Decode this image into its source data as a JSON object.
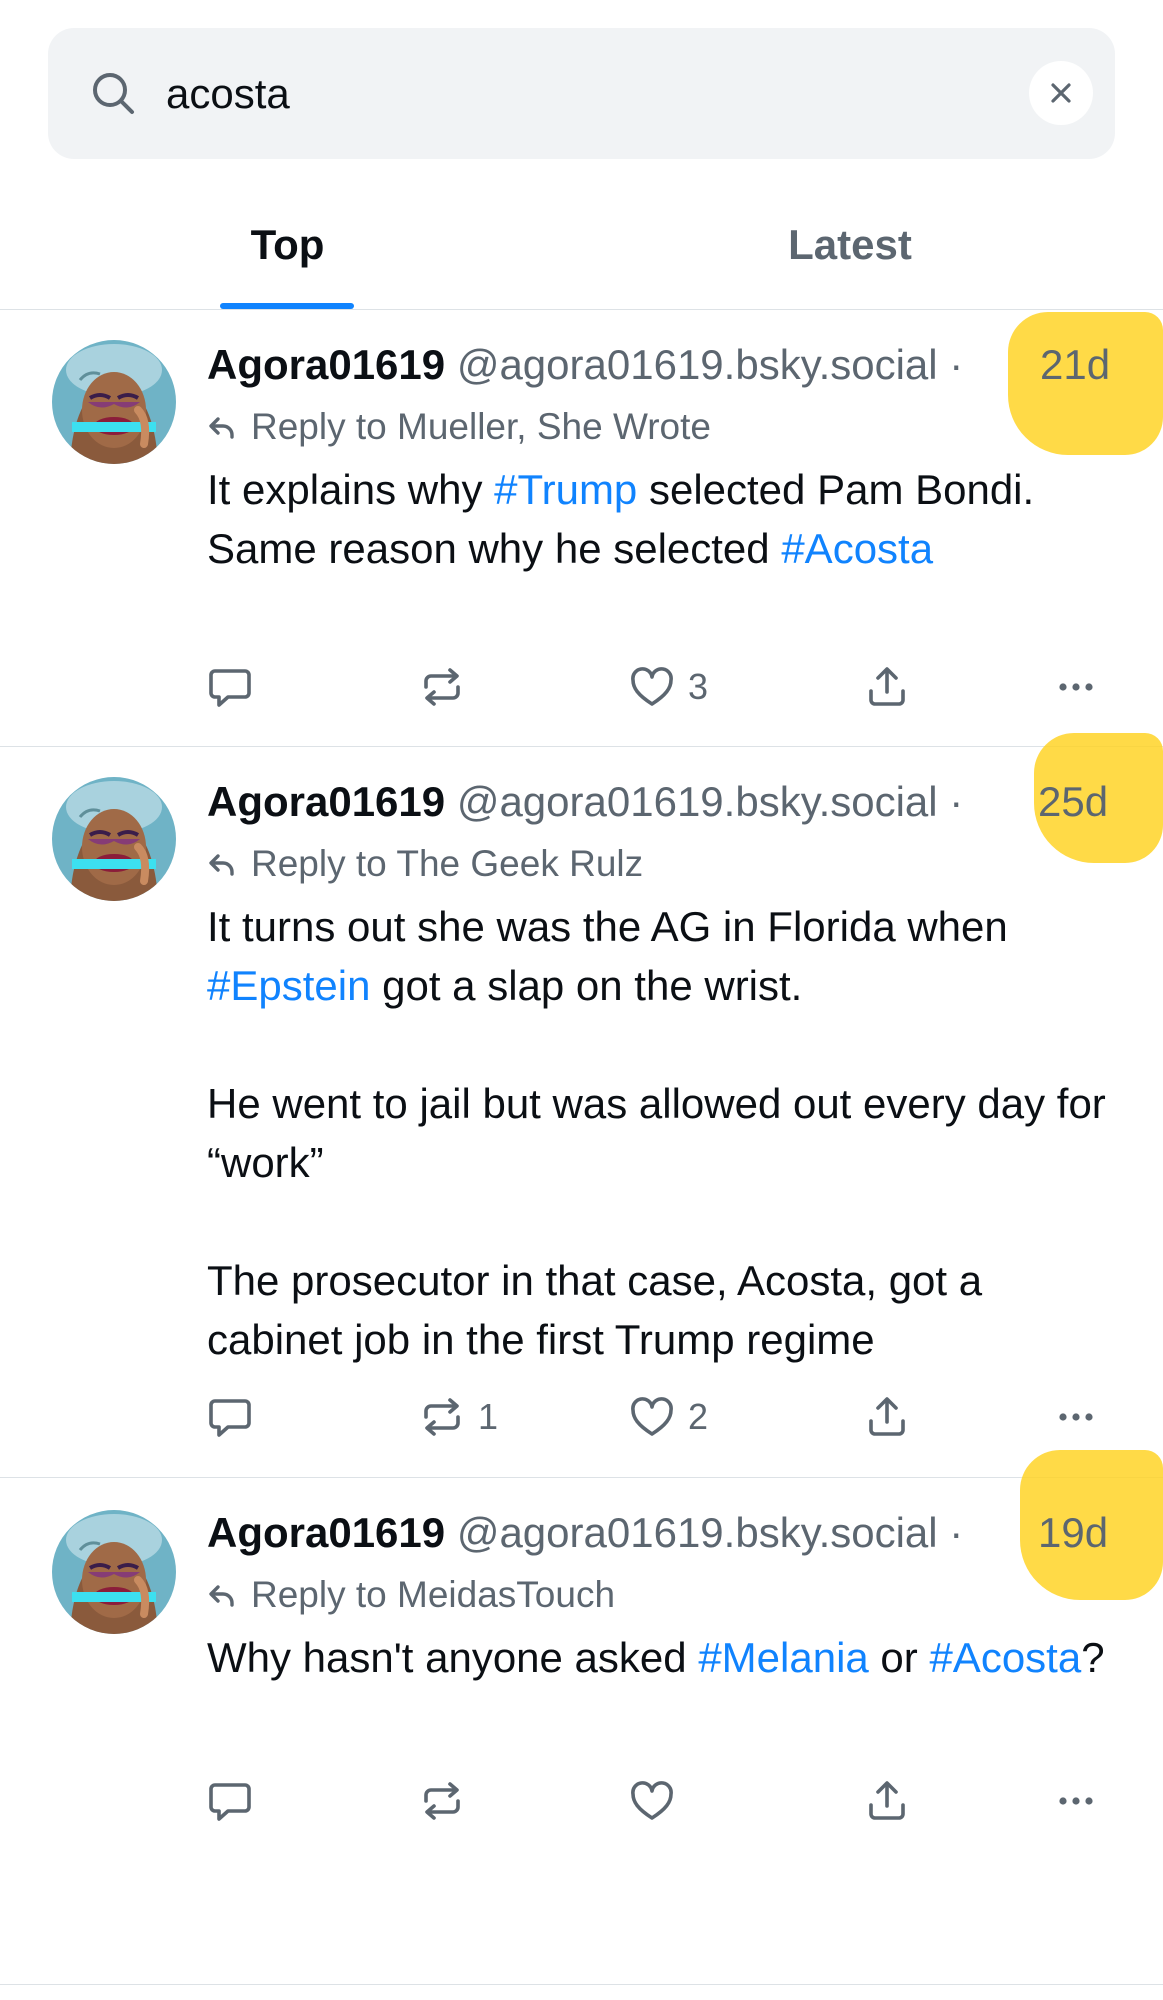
{
  "search": {
    "query": "acosta"
  },
  "tabs": [
    {
      "label": "Top"
    },
    {
      "label": "Latest"
    }
  ],
  "colors": {
    "accent": "#1083fe",
    "muted": "#5c6670",
    "highlight": "#ffd21f"
  },
  "icons": {
    "search": "search-icon",
    "clear": "close-icon",
    "reply": "reply-arrow-icon",
    "comment": "comment-icon",
    "repost": "repost-icon",
    "like": "heart-icon",
    "share": "share-icon",
    "more": "more-icon"
  },
  "posts": [
    {
      "display_name": "Agora01619",
      "handle": "@agora01619.bsky.social",
      "separator": "·",
      "time": "21d",
      "reply_to": "Reply to Mueller, She Wrote",
      "text": {
        "t1": "It explains why ",
        "tag1": "#Trump",
        "t2": " selected Pam Bondi.",
        "t3": "Same reason why he selected ",
        "tag2": "#Acosta"
      },
      "counts": {
        "reposts": "",
        "likes": "3"
      }
    },
    {
      "display_name": "Agora01619",
      "handle": "@agora01619.bsky.social",
      "separator": "·",
      "time": "25d",
      "reply_to": "Reply to The Geek Rulz",
      "text": {
        "t1": "It turns out she was the AG in Florida when ",
        "tag1": "#Epstein",
        "t2": " got a slap on the wrist.",
        "p2": "He went to jail but was allowed out every day for “work”",
        "p3": "The prosecutor in that case, Acosta, got a cabinet job in the first Trump regime"
      },
      "counts": {
        "reposts": "1",
        "likes": "2"
      }
    },
    {
      "display_name": "Agora01619",
      "handle": "@agora01619.bsky.social",
      "separator": "·",
      "time": "19d",
      "reply_to": "Reply to MeidasTouch",
      "text": {
        "t1": "Why hasn't anyone asked ",
        "tag1": "#Melania",
        "t2": " or ",
        "tag2": "#Acosta",
        "t3": "?"
      },
      "counts": {
        "reposts": "",
        "likes": ""
      }
    }
  ]
}
